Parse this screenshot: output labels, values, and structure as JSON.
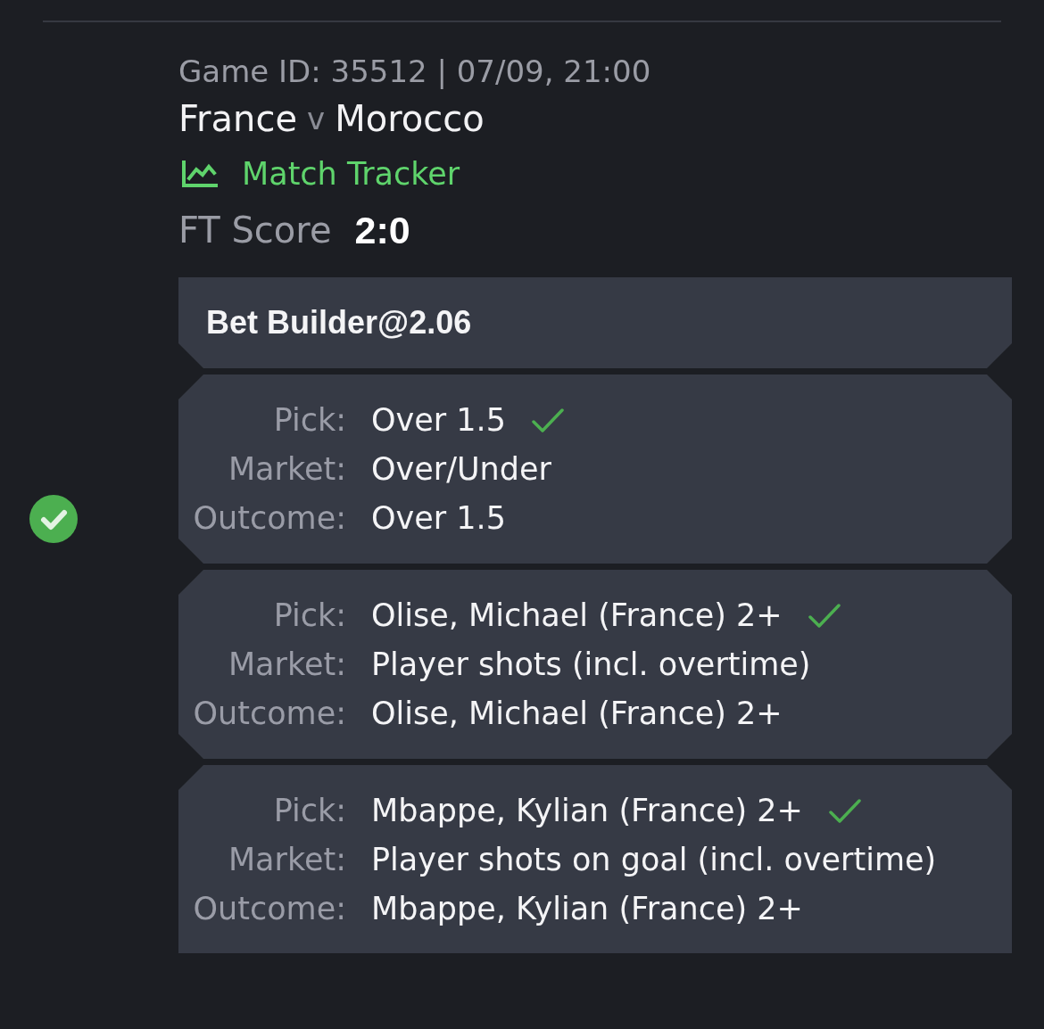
{
  "header": {
    "game_info": "Game ID: 35512 | 07/09, 21:00",
    "home_team": "France",
    "versus": "v",
    "away_team": "Morocco",
    "tracker_link": "Match Tracker",
    "score_label": "FT Score",
    "score": "2:0"
  },
  "bet": {
    "won": true,
    "title": "Bet Builder@2.06",
    "legs": [
      {
        "won": true,
        "fields": [
          {
            "label": "Pick:",
            "value": "Over 1.5"
          },
          {
            "label": "Market:",
            "value": "Over/Under"
          },
          {
            "label": "Outcome:",
            "value": "Over 1.5"
          }
        ]
      },
      {
        "won": true,
        "fields": [
          {
            "label": "Pick:",
            "value": "Olise, Michael (France) 2+"
          },
          {
            "label": "Market:",
            "value": "Player shots (incl. overtime)"
          },
          {
            "label": "Outcome:",
            "value": "Olise, Michael (France) 2+"
          }
        ]
      },
      {
        "won": true,
        "fields": [
          {
            "label": "Pick:",
            "value": "Mbappe, Kylian (France) 2+"
          },
          {
            "label": "Market:",
            "value": "Player shots on goal (incl. overtime)"
          },
          {
            "label": "Outcome:",
            "value": "Mbappe, Kylian (France) 2+"
          }
        ]
      }
    ]
  }
}
